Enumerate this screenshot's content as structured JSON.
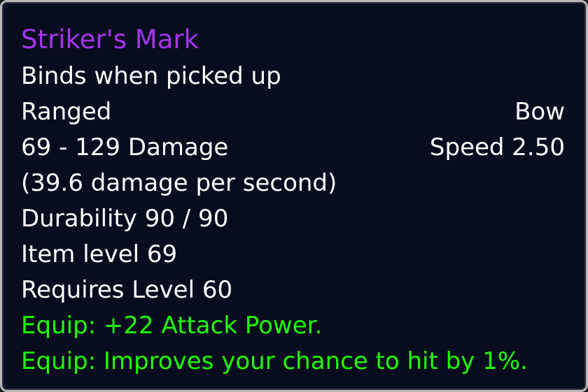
{
  "tooltip": {
    "name": "Striker's Mark",
    "name_color": "#a335ee",
    "bind": "Binds when picked up",
    "slot": "Ranged",
    "type": "Bow",
    "damage": "69 - 129 Damage",
    "speed": "Speed 2.50",
    "dps": "(39.6 damage per second)",
    "durability": "Durability 90 / 90",
    "item_level": "Item level 69",
    "requires": "Requires Level 60",
    "equip_color": "#1eff00",
    "equips": [
      "Equip: +22 Attack Power.",
      "Equip: Improves your chance to hit by 1%."
    ]
  }
}
